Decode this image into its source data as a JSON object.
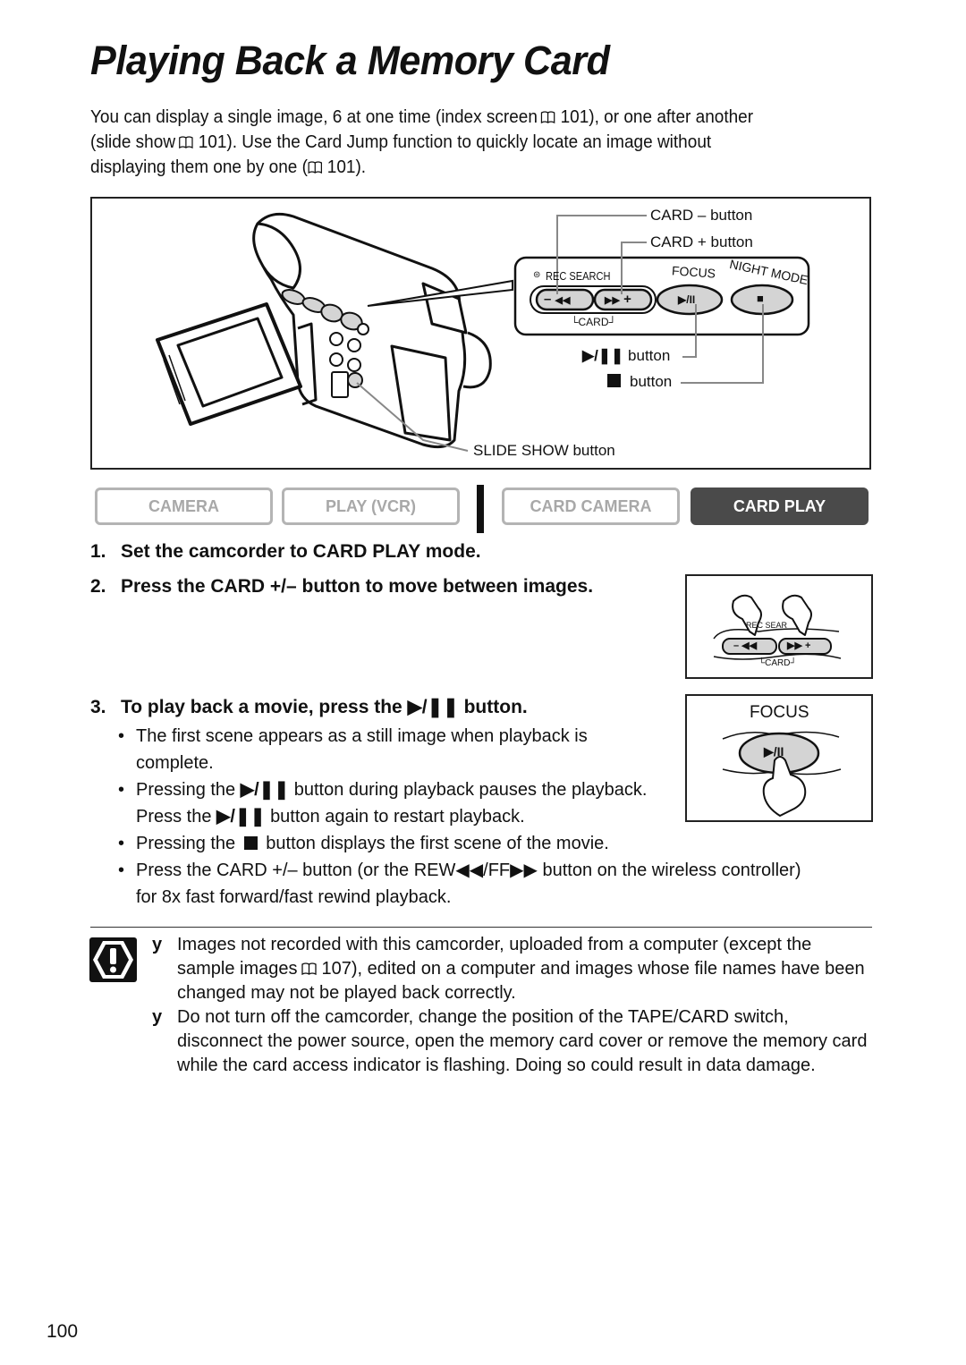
{
  "page": {
    "title": "Playing Back a Memory Card",
    "intro": {
      "line1_a": "You can display a single image, 6 at one time (index screen",
      "line1_b": "101), or one after another",
      "line2_a": "(slide show",
      "line2_b": "101). Use the Card Jump function to quickly locate an image without",
      "line3_a": "displaying them one by one (",
      "line3_b": "101)."
    },
    "page_number": "100"
  },
  "figure": {
    "callouts": {
      "card_minus": "CARD – button",
      "card_plus": "CARD + button",
      "play_pause": "button",
      "stop": "button",
      "slide_show": "SLIDE SHOW button"
    },
    "panel_labels": {
      "rec_search": "REC SEARCH",
      "focus": "FOCUS",
      "night_mode": "NIGHT MODE",
      "card": "CARD",
      "minus": "–",
      "plus": "+",
      "rew": "◀◀",
      "ff": "▶▶",
      "play_pause": "▶/II",
      "stop": "■"
    }
  },
  "modes": [
    {
      "label": "CAMERA",
      "active": false
    },
    {
      "label": "PLAY (VCR)",
      "active": false
    },
    {
      "label": "CARD CAMERA",
      "active": false
    },
    {
      "label": "CARD PLAY",
      "active": true
    }
  ],
  "steps": [
    {
      "num": "1.",
      "text": "Set the camcorder to CARD PLAY mode."
    },
    {
      "num": "2.",
      "text": "Press the CARD +/– button to move between images."
    },
    {
      "num": "3.",
      "text_a": "To play back a movie, press the",
      "icon": "▶/II",
      "text_b": "button."
    }
  ],
  "bullets": {
    "b1": "The first scene appears as a still image when playback is complete.",
    "b2_a": "Pressing the",
    "b2_b": "button during playback pauses the playback. Press the",
    "b2_c": "button again to restart playback.",
    "b3_a": "Pressing the",
    "b3_b": "button displays the first scene of the movie.",
    "b4_a": "Press the CARD +/– button (or the REW",
    "b4_rew": "◀◀",
    "b4_mid": "/FF",
    "b4_ff": "▶▶",
    "b4_b": "button on the wireless controller) for 8x fast forward/fast rewind playback.",
    "play_icon": "▶/II"
  },
  "cautions": {
    "marker": "y",
    "n1_a": "Images not recorded with this camcorder, uploaded from a computer (except the sample images",
    "n1_b": "107), edited on a computer and images whose file names have been changed may not be played back correctly.",
    "n2": "Do not turn off the camcorder, change the position of the TAPE/CARD switch, disconnect the power source, open the memory card cover or remove the memory card while the card access indicator is flashing. Doing so could result in data damage."
  },
  "side_panels": {
    "card_panel": {
      "rec_search": "REC SEAR",
      "card": "CARD",
      "minus": "–",
      "plus": "+"
    },
    "focus_panel": {
      "focus": "FOCUS",
      "play_pause": "▶/II"
    }
  }
}
